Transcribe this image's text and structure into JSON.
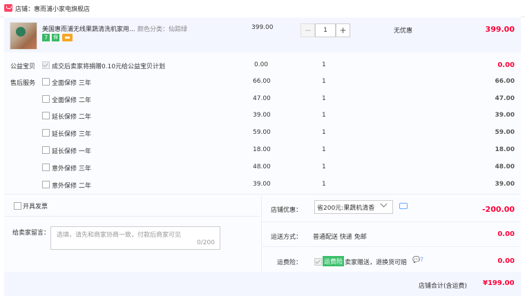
{
  "shop": {
    "prefix": "店铺：",
    "name": "惠而浦小家电旗舰店"
  },
  "item": {
    "title": "美国惠而浦无线果蔬清洗机家用...",
    "sku_label": "颜色分类：仙踪绿",
    "badges": [
      "7",
      "保",
      "card"
    ],
    "price": "399.00",
    "quantity": "1",
    "minus": "−",
    "plus": "+",
    "discount": "无优惠",
    "total": "399.00"
  },
  "charity": {
    "label": "公益宝贝",
    "text": "成交后卖家将捐赠0.10元给公益宝贝计划",
    "price": "0.00",
    "qty": "1",
    "total": "0.00"
  },
  "service": {
    "label": "售后服务",
    "options": [
      {
        "text": "全面保修 三年",
        "price": "66.00",
        "qty": "1",
        "total": "66.00"
      },
      {
        "text": "全面保修 二年",
        "price": "47.00",
        "qty": "1",
        "total": "47.00"
      },
      {
        "text": "延长保修 二年",
        "price": "39.00",
        "qty": "1",
        "total": "39.00"
      },
      {
        "text": "延长保修 三年",
        "price": "59.00",
        "qty": "1",
        "total": "59.00"
      },
      {
        "text": "延长保修 一年",
        "price": "18.00",
        "qty": "1",
        "total": "18.00"
      },
      {
        "text": "意外保修 三年",
        "price": "48.00",
        "qty": "1",
        "total": "48.00"
      },
      {
        "text": "意外保修 二年",
        "price": "39.00",
        "qty": "1",
        "total": "39.00"
      }
    ]
  },
  "invoice": {
    "label": "开具发票"
  },
  "message": {
    "label": "给卖家留言：",
    "placeholder": "选填，请先和商家协商一致，付款后商家可见",
    "count": "0/200"
  },
  "coupon": {
    "label": "店铺优惠：",
    "value": "省200元:果蔬机清香",
    "amount": "-200.00"
  },
  "shipping": {
    "label": "运送方式：",
    "value": "普通配送 快递 免邮",
    "amount": "0.00"
  },
  "insurance": {
    "label": "运费险：",
    "tag": "运费险",
    "text": "卖家赠送，退换货可赔",
    "amount": "0.00"
  },
  "footer": {
    "label": "店铺合计(含运费)",
    "total": "¥199.00"
  },
  "colors": {
    "accent_red": "#ff0036",
    "row_bg": "#f3f6ff",
    "green": "#38b865"
  }
}
